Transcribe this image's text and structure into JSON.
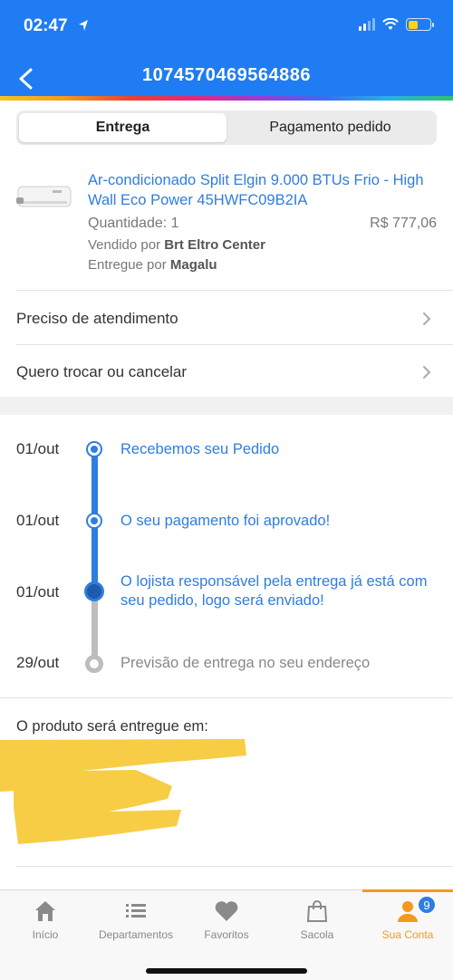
{
  "status_bar": {
    "time": "02:47"
  },
  "header": {
    "title": "1074570469564886"
  },
  "tabs": [
    {
      "label": "Entrega",
      "active": true
    },
    {
      "label": "Pagamento pedido",
      "active": false
    }
  ],
  "product": {
    "name": "Ar-condicionado Split Elgin 9.000 BTUs Frio - High Wall Eco Power 45HWFC09B2IA",
    "quantity": "Quantidade: 1",
    "price": "R$ 777,06",
    "seller_prefix": "Vendido por ",
    "seller": "Brt Eltro Center",
    "delivered_prefix": "Entregue por ",
    "delivered_by": "Magalu"
  },
  "menu": [
    {
      "label": "Preciso de atendimento"
    },
    {
      "label": "Quero trocar ou cancelar"
    }
  ],
  "timeline": [
    {
      "date": "01/out",
      "text": "Recebemos seu Pedido",
      "status": "done"
    },
    {
      "date": "01/out",
      "text": "O seu pagamento foi aprovado!",
      "status": "done"
    },
    {
      "date": "01/out",
      "text": "O lojista responsável pela entrega já está com seu pedido, logo será enviado!",
      "status": "current"
    },
    {
      "date": "29/out",
      "text": "Previsão de entrega no seu endereço",
      "status": "pending"
    }
  ],
  "delivery": {
    "label": "O produto será entregue em:"
  },
  "tab_bar": {
    "items": [
      {
        "label": "Início",
        "icon": "home-icon"
      },
      {
        "label": "Departamentos",
        "icon": "list-icon"
      },
      {
        "label": "Favoritos",
        "icon": "heart-icon"
      },
      {
        "label": "Sacola",
        "icon": "bag-icon"
      },
      {
        "label": "Sua Conta",
        "icon": "user-icon",
        "active": true
      }
    ],
    "badge": "9"
  },
  "colors": {
    "brand_blue": "#1f7cf2",
    "link_blue": "#2f7de0",
    "active_orange": "#f39a1d",
    "redaction_yellow": "#f7cd45"
  }
}
